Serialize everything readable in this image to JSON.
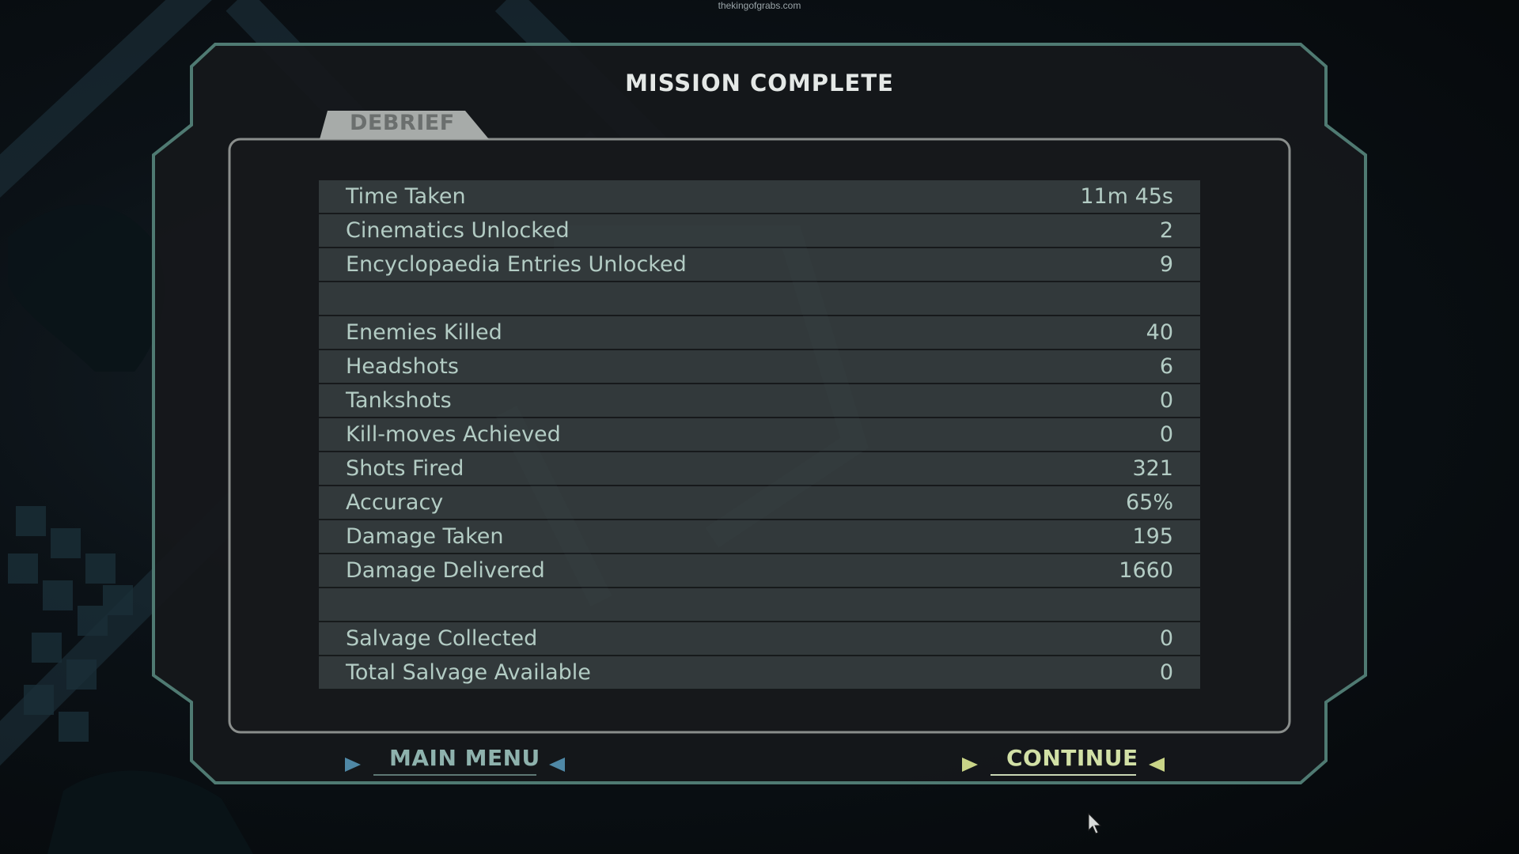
{
  "watermark": "thekingofgrabs.com",
  "screen_title": "MISSION COMPLETE",
  "tab_label": "DEBRIEF",
  "stats": [
    {
      "label": "Time Taken",
      "value": "11m 45s"
    },
    {
      "label": "Cinematics Unlocked",
      "value": "2"
    },
    {
      "label": "Encyclopaedia Entries Unlocked",
      "value": "9"
    },
    {
      "label": "",
      "value": ""
    },
    {
      "label": "Enemies Killed",
      "value": "40"
    },
    {
      "label": "Headshots",
      "value": "6"
    },
    {
      "label": "Tankshots",
      "value": "0"
    },
    {
      "label": "Kill-moves Achieved",
      "value": "0"
    },
    {
      "label": "Shots Fired",
      "value": "321"
    },
    {
      "label": "Accuracy",
      "value": "65%"
    },
    {
      "label": "Damage Taken",
      "value": "195"
    },
    {
      "label": "Damage Delivered",
      "value": "1660"
    },
    {
      "label": "",
      "value": ""
    },
    {
      "label": "Salvage Collected",
      "value": "0"
    },
    {
      "label": "Total Salvage Available",
      "value": "0"
    }
  ],
  "buttons": {
    "main_menu": "MAIN MENU",
    "continue": "CONTINUE"
  },
  "colors": {
    "frame": "#4f7a72",
    "panel_border": "#8a8e8c",
    "stat_text": "#b3ccc4",
    "continue_text": "#d2e0a6",
    "main_menu_text": "#8eb2ad"
  }
}
